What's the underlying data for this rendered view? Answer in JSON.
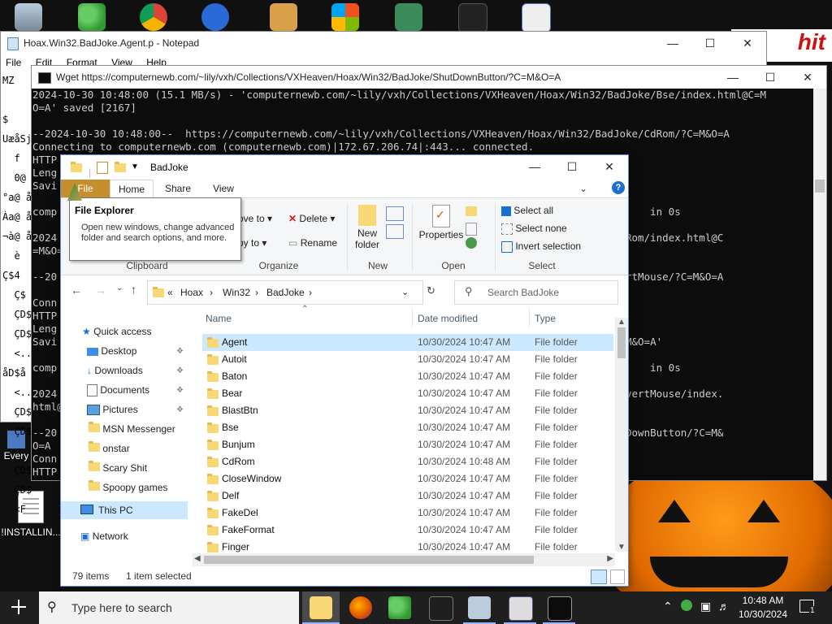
{
  "desktop": {
    "logo_text": "hit",
    "left_items": [
      {
        "label": "Every"
      },
      {
        "label": "!INSTALLIN..."
      }
    ]
  },
  "notepad": {
    "title": "Hoax.Win32.BadJoke.Agent.p - Notepad",
    "menu": [
      "File",
      "Edit",
      "Format",
      "View",
      "Help"
    ],
    "lines": [
      "MZ",
      "",
      "$",
      "UæåSј",
      "  f",
      "  0@ å",
      "°a@ å",
      "Àa@ å",
      "¬à@ å",
      "  è",
      "Ç$4",
      "  Ç$",
      "  ÇD$",
      "  ÇD$",
      "  <..h",
      "åD$å",
      "  <..h",
      "  ÇD$",
      "  ÇD$",
      "  <..",
      "  ÇD$",
      "  ÇD$",
      "  <F"
    ],
    "controls": {
      "minimize": "—",
      "maximize": "☐",
      "close": "✕"
    }
  },
  "terminal": {
    "title": "Wget https://computernewb.com/~lily/vxh/Collections/VXHeaven/Hoax/Win32/BadJoke/ShutDownButton/?C=M&O=A",
    "lines": [
      "2024-10-30 10:48:00 (15.1 MB/s) - 'computernewb.com/~lily/vxh/Collections/VXHeaven/Hoax/Win32/BadJoke/Bse/index.html@C=M",
      "O=A' saved [2167]",
      "",
      "--2024-10-30 10:48:00--  https://computernewb.com/~lily/vxh/Collections/VXHeaven/Hoax/Win32/BadJoke/CdRom/?C=M&O=A",
      "Connecting to computernewb.com (computernewb.com)|172.67.206.74|:443... connected.",
      "HTTP",
      "Leng",
      "Savi                                                                                 tml@C=M&O=A'",
      "",
      "comp                                                                                 3K  --.-KB/s    in 0s",
      "",
      "2024                                                                                 2/BadJoke/CdRom/index.html@C",
      "=M&O=",
      "",
      "--20                                                                                 BadJoke/InvertMouse/?C=M&O=A",
      "",
      "Conn",
      "HTTP",
      "Leng",
      "Savi                                                                                 ndex.html@C=M&O=A'",
      "",
      "comp                                                                                 6K  --.-KB/s    in 0s",
      "",
      "2024                                                                                 2/BadJoke/InvertMouse/index.",
      "html@",
      "",
      "--20                                                                                 BadJoke/ShutDownButton/?C=M&",
      "O=A",
      "Conn",
      "HTTP"
    ],
    "controls": {
      "minimize": "—",
      "maximize": "☐",
      "close": "✕"
    }
  },
  "explorer": {
    "title": "BadJoke",
    "tabs": {
      "file": "File",
      "home": "Home",
      "share": "Share",
      "view": "View"
    },
    "controls": {
      "minimize": "—",
      "maximize": "☐",
      "close": "✕"
    },
    "tooltip": {
      "title": "File Explorer",
      "body": "Open new windows, change advanced folder and search options, and more."
    },
    "ribbon": {
      "move_to": "ove to",
      "copy_to": "py to",
      "delete": "Delete",
      "rename": "Rename",
      "new_folder_line1": "New",
      "new_folder_line2": "folder",
      "properties": "Properties",
      "select_all": "Select all",
      "select_none": "Select none",
      "invert_selection": "Invert selection",
      "groups": {
        "clipboard": "Clipboard",
        "organize": "Organize",
        "new": "New",
        "open": "Open",
        "select": "Select"
      }
    },
    "address": {
      "prefix": "«",
      "crumbs": [
        "Hoax",
        "Win32",
        "BadJoke"
      ]
    },
    "search_placeholder": "Search BadJoke",
    "nav": [
      {
        "label": "Quick access",
        "kind": "star"
      },
      {
        "label": "Desktop",
        "kind": "desktop",
        "pinned": true
      },
      {
        "label": "Downloads",
        "kind": "download",
        "pinned": true
      },
      {
        "label": "Documents",
        "kind": "docs",
        "pinned": true
      },
      {
        "label": "Pictures",
        "kind": "pictures",
        "pinned": true
      },
      {
        "label": "MSN Messenger",
        "kind": "folder"
      },
      {
        "label": "onstar",
        "kind": "folder"
      },
      {
        "label": "Scary Shit",
        "kind": "folder"
      },
      {
        "label": "Spoopy games",
        "kind": "folder"
      },
      {
        "label": "This PC",
        "kind": "pc",
        "selected": true
      },
      {
        "label": "Network",
        "kind": "network"
      }
    ],
    "columns": {
      "name": "Name",
      "date": "Date modified",
      "type": "Type"
    },
    "rows": [
      {
        "name": "Agent",
        "date": "10/30/2024 10:47 AM",
        "type": "File folder",
        "selected": true
      },
      {
        "name": "Autoit",
        "date": "10/30/2024 10:47 AM",
        "type": "File folder"
      },
      {
        "name": "Baton",
        "date": "10/30/2024 10:47 AM",
        "type": "File folder"
      },
      {
        "name": "Bear",
        "date": "10/30/2024 10:47 AM",
        "type": "File folder"
      },
      {
        "name": "BlastBtn",
        "date": "10/30/2024 10:47 AM",
        "type": "File folder"
      },
      {
        "name": "Bse",
        "date": "10/30/2024 10:47 AM",
        "type": "File folder"
      },
      {
        "name": "Bunjum",
        "date": "10/30/2024 10:47 AM",
        "type": "File folder"
      },
      {
        "name": "CdRom",
        "date": "10/30/2024 10:48 AM",
        "type": "File folder"
      },
      {
        "name": "CloseWindow",
        "date": "10/30/2024 10:47 AM",
        "type": "File folder"
      },
      {
        "name": "Delf",
        "date": "10/30/2024 10:47 AM",
        "type": "File folder"
      },
      {
        "name": "FakeDel",
        "date": "10/30/2024 10:47 AM",
        "type": "File folder"
      },
      {
        "name": "FakeFormat",
        "date": "10/30/2024 10:47 AM",
        "type": "File folder"
      },
      {
        "name": "Finger",
        "date": "10/30/2024 10:47 AM",
        "type": "File folder"
      }
    ],
    "status": {
      "items": "79 items",
      "selected": "1 item selected"
    }
  },
  "taskbar": {
    "search_placeholder": "Type here to search",
    "time": "10:48 AM",
    "date": "10/30/2024",
    "notifications": "1",
    "colors": {
      "bar": "#1f1f1f",
      "accent": "#9ab4ff"
    }
  }
}
